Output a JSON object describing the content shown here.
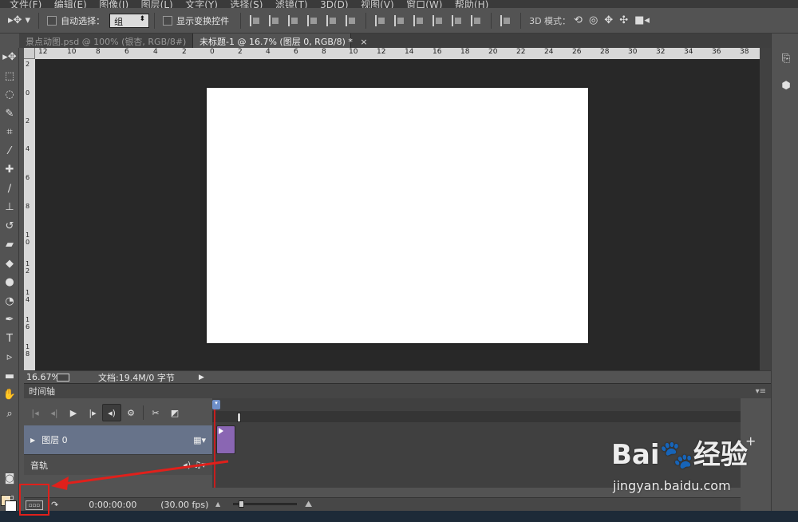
{
  "menubar": {
    "items": [
      "文件(F)",
      "编辑(E)",
      "图像(I)",
      "图层(L)",
      "文字(Y)",
      "选择(S)",
      "滤镜(T)",
      "3D(D)",
      "视图(V)",
      "窗口(W)",
      "帮助(H)"
    ]
  },
  "options": {
    "auto_select_label": "自动选择：",
    "auto_select_value": "组",
    "show_transform_label": "显示变换控件",
    "mode_3d_label": "3D 模式："
  },
  "tabs": [
    {
      "label": "景点动图.psd @ 100% (银杏, RGB/8#)",
      "close": "×"
    },
    {
      "label": "未标题-1 @ 16.7% (图层 0, RGB/8) *",
      "close": "×"
    }
  ],
  "ruler": {
    "h": [
      "12",
      "10",
      "8",
      "6",
      "4",
      "2",
      "0",
      "2",
      "4",
      "6",
      "8",
      "10",
      "12",
      "14",
      "16",
      "18",
      "20",
      "22",
      "24",
      "26",
      "28",
      "30",
      "32",
      "34",
      "36",
      "38"
    ],
    "v": [
      "2",
      "0",
      "2",
      "4",
      "6",
      "8",
      "1 0",
      "1 2",
      "1 4",
      "1 6",
      "1 8"
    ]
  },
  "status": {
    "zoom": "16.67%",
    "doc_size": "文档:19.4M/0 字节",
    "arrow": "▶"
  },
  "timeline": {
    "title": "时间轴",
    "menu": "▾≡",
    "layer_name": "图层 0",
    "audio_name": "音轨",
    "timecode": "0:00:00:00",
    "fps": "(30.00 fps)",
    "convert_label": "▫▫▫",
    "add": "+"
  },
  "watermark": {
    "logo": "Bai🐾经验",
    "url": "jingyan.baidu.com"
  },
  "colors": {
    "accent_red": "#e0201b",
    "foreground": "#f6e0b6",
    "background": "#ffffff",
    "clip": "#8a66b3",
    "layer_row": "#67738a"
  }
}
